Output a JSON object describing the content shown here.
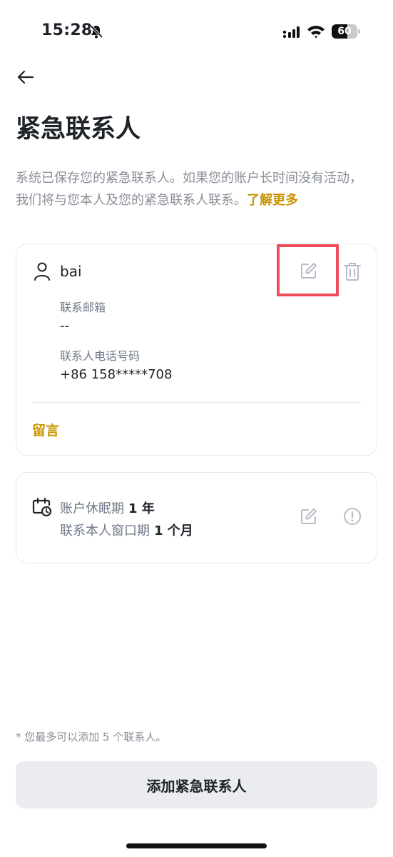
{
  "status_bar": {
    "time": "15:28",
    "battery_level": "60",
    "battery_fraction": 0.6,
    "icons": [
      "bell-muted-icon",
      "signal-icon",
      "wifi-icon",
      "battery-icon"
    ]
  },
  "header": {
    "back_icon": "arrow-left-icon",
    "title": "紧急联系人"
  },
  "description": {
    "text": "系统已保存您的紧急联系人。如果您的账户长时间没有活动，我们将与您本人及您的紧急联系人联系。",
    "link": "了解更多"
  },
  "contact_card": {
    "name": "bai",
    "email_label": "联系邮箱",
    "email_value": "--",
    "phone_label": "联系人电话号码",
    "phone_value": "+86 158*****708",
    "message_link": "留言",
    "icons": [
      "person-icon",
      "edit-icon",
      "trash-icon"
    ]
  },
  "dormancy_card": {
    "dormancy_label": "账户休眠期",
    "dormancy_value": "1 年",
    "window_label": "联系本人窗口期",
    "window_value": "1 个月",
    "icons": [
      "calendar-clock-icon",
      "edit-icon",
      "info-icon"
    ]
  },
  "footer": {
    "note": "* 您最多可以添加 5 个联系人。",
    "add_button": "添加紧急联系人"
  },
  "colors": {
    "accent": "#c99400",
    "highlight": "#ef4d5c",
    "text_primary": "#1e2329",
    "text_secondary": "#8a8f98",
    "button_bg": "#eaecef"
  }
}
